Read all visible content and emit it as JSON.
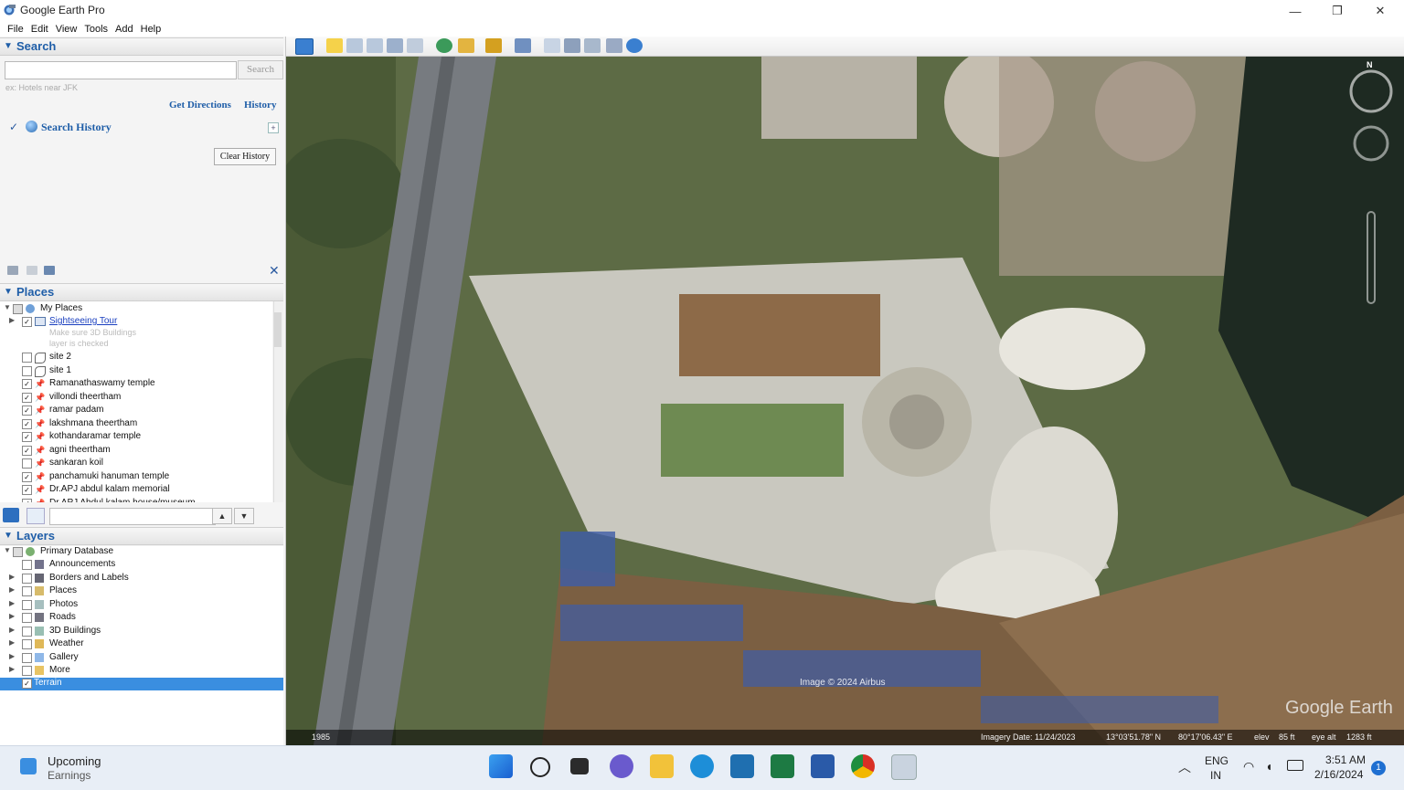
{
  "app": {
    "title": "Google Earth Pro",
    "window_controls": {
      "minimize": "—",
      "restore": "❐",
      "close": "✕"
    }
  },
  "menu": [
    "File",
    "Edit",
    "View",
    "Tools",
    "Add",
    "Help"
  ],
  "search": {
    "header": "Search",
    "input_value": "",
    "button_label": "Search",
    "hint": "ex: Hotels near JFK",
    "get_directions": "Get Directions",
    "history": "History",
    "search_history_label": "Search History",
    "clear_history": "Clear History"
  },
  "places": {
    "header": "Places",
    "root": "My Places",
    "tour": "Sightseeing Tour",
    "tour_note1": "Make sure 3D Buildings",
    "tour_note2": "layer is checked",
    "items": [
      {
        "label": "site 2",
        "checked": false,
        "type": "polygon"
      },
      {
        "label": "site 1",
        "checked": false,
        "type": "polygon"
      },
      {
        "label": "Ramanathaswamy temple",
        "checked": true,
        "type": "pin"
      },
      {
        "label": "villondi theertham",
        "checked": true,
        "type": "pin"
      },
      {
        "label": "ramar padam",
        "checked": true,
        "type": "pin"
      },
      {
        "label": "lakshmana theertham",
        "checked": true,
        "type": "pin"
      },
      {
        "label": "kothandaramar temple",
        "checked": true,
        "type": "pin"
      },
      {
        "label": "agni theertham",
        "checked": true,
        "type": "pin"
      },
      {
        "label": "sankaran koil",
        "checked": false,
        "type": "pin"
      },
      {
        "label": "panchamuki hanuman temple",
        "checked": true,
        "type": "pin"
      },
      {
        "label": "Dr.APJ abdul kalam memorial",
        "checked": true,
        "type": "pin"
      },
      {
        "label": "Dr.APJ Abdul kalam house/museum",
        "checked": true,
        "type": "pin"
      }
    ],
    "nav_up": "▲",
    "nav_down": "▼"
  },
  "layers": {
    "header": "Layers",
    "root": "Primary Database",
    "items": [
      {
        "label": "Announcements",
        "icon": "envelope-icon"
      },
      {
        "label": "Borders and Labels",
        "icon": "flag-icon"
      },
      {
        "label": "Places",
        "icon": "places-icon"
      },
      {
        "label": "Photos",
        "icon": "photo-icon"
      },
      {
        "label": "Roads",
        "icon": "road-icon"
      },
      {
        "label": "3D Buildings",
        "icon": "building-icon"
      },
      {
        "label": "Weather",
        "icon": "sun-icon"
      },
      {
        "label": "Gallery",
        "icon": "star-icon"
      },
      {
        "label": "More",
        "icon": "folder-icon"
      }
    ],
    "selected": "Terrain"
  },
  "map": {
    "attribution": "Image © 2024 Airbus",
    "logo": "Google Earth",
    "compass_n": "N",
    "status": {
      "year": "1985",
      "imagery_date": "Imagery Date: 11/24/2023",
      "lat": "13°03'51.78\" N",
      "lon": "80°17'06.43\" E",
      "elev_label": "elev",
      "elev": "85 ft",
      "eye_label": "eye alt",
      "eye": "1283 ft"
    }
  },
  "taskbar": {
    "weather_title": "Upcoming",
    "weather_sub": "Earnings",
    "lang1": "ENG",
    "lang2": "IN",
    "time": "3:51 AM",
    "date": "2/16/2024",
    "notifications": "1"
  }
}
